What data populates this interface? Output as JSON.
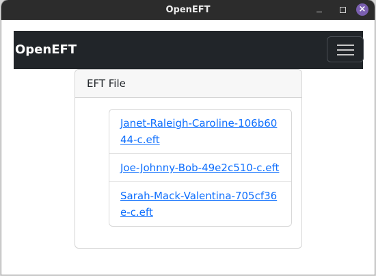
{
  "window": {
    "title": "OpenEFT",
    "controls": {
      "minimize_icon": "minimize-icon",
      "maximize_icon": "maximize-icon",
      "close_icon": "close-icon",
      "close_glyph": "×"
    }
  },
  "navbar": {
    "brand": "OpenEFT",
    "toggler_icon": "hamburger-icon"
  },
  "card": {
    "header": "EFT File",
    "files": [
      {
        "label": "Janet-Raleigh-Caroline-106b6044-c.eft"
      },
      {
        "label": "Joe-Johnny-Bob-49e2c510-c.eft"
      },
      {
        "label": "Sarah-Mack-Valentina-705cf36e-c.eft"
      }
    ]
  },
  "colors": {
    "titlebar": "#2c2c2c",
    "navbar": "#212529",
    "link": "#0d6efd",
    "close_button": "#7a5fb0"
  }
}
